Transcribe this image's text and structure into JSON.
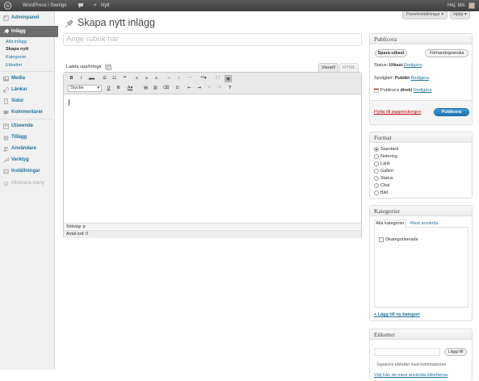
{
  "admin_bar": {
    "site_name": "WordPress i Sverige",
    "new_label": "Nytt",
    "greeting": "Hej, Idis"
  },
  "menu": {
    "dashboard": "Adminpanel",
    "posts": "Inlägg",
    "posts_sub": [
      "Alla inlägg",
      "Skapa nytt",
      "Kategorier",
      "Etiketter"
    ],
    "media": "Media",
    "links": "Länkar",
    "pages": "Sidor",
    "comments": "Kommentarer",
    "appearance": "Utseende",
    "plugins": "Tillägg",
    "users": "Användare",
    "tools": "Verktyg",
    "settings": "Inställningar",
    "collapse": "Minimera meny"
  },
  "screen_meta": {
    "panel_settings": "Panelinställningar",
    "help": "Hjälp"
  },
  "page": {
    "title": "Skapa nytt inlägg",
    "title_placeholder": "Ange rubrik här"
  },
  "editor": {
    "upload_label": "Ladda upp/Infoga",
    "tab_visual": "Visuell",
    "tab_html": "HTML",
    "format_select": "Stycke",
    "path_label": "Sökväg: p",
    "word_count": "Antal ord: 0"
  },
  "publish": {
    "title": "Publicera",
    "save_draft": "Spara utkast",
    "preview": "Förhandsgranska",
    "status_label": "Status:",
    "status_value": "Utkast",
    "visibility_label": "Synlighet:",
    "visibility_value": "Publikt",
    "publish_label": "Publicera",
    "publish_value": "direkt",
    "edit": "Redigera",
    "trash": "Flytta till papperskorgen",
    "publish_button": "Publicera"
  },
  "format": {
    "title": "Format",
    "options": [
      "Standard",
      "Notering",
      "Länk",
      "Galleri",
      "Status",
      "Citat",
      "Bild"
    ],
    "selected": "Standard"
  },
  "categories": {
    "title": "Kategorier",
    "tab_all": "Alla kategorier",
    "tab_popular": "Mest använda",
    "items": [
      "Okategoriserade"
    ],
    "add_new": "+ Lägg till ny kategori"
  },
  "tags": {
    "title": "Etiketter",
    "add_button": "Lägg till",
    "hint": "Separera etiketter med kommatecken",
    "choose_popular": "Välj från de mest använda etiketterna"
  },
  "colors": {
    "admin_bar": "#464646",
    "link": "#21759b",
    "active_menu": "#6d6d6d",
    "primary_button": "#2a87c9",
    "trash": "#bc0b0b"
  }
}
